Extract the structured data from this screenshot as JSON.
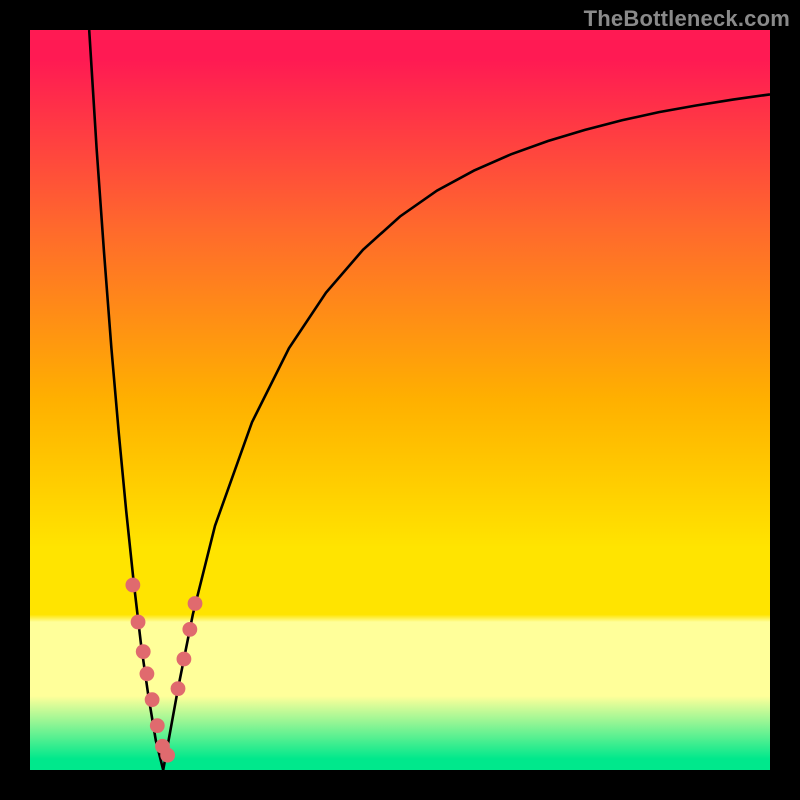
{
  "watermark": "TheBottleneck.com",
  "colors": {
    "gradient_top": "#ff1a53",
    "gradient_mid1": "#ff6a2c",
    "gradient_mid2": "#ffb000",
    "gradient_mid3": "#ffe400",
    "gradient_band": "#ffff9a",
    "gradient_bottom": "#00e88c",
    "curve": "#000000",
    "marker": "#e06a6e",
    "frame": "#000000"
  },
  "chart_data": {
    "type": "line",
    "title": "",
    "xlabel": "",
    "ylabel": "",
    "xlim": [
      0,
      100
    ],
    "ylim": [
      0,
      100
    ],
    "x_optimum": 18,
    "series": [
      {
        "name": "left-branch",
        "x": [
          8.0,
          9.0,
          10.0,
          11.0,
          12.0,
          13.0,
          14.0,
          15.0,
          16.0,
          17.0,
          18.0
        ],
        "values": [
          100.0,
          84.0,
          70.0,
          57.0,
          45.5,
          35.0,
          25.5,
          17.0,
          10.0,
          4.0,
          0.0
        ]
      },
      {
        "name": "right-branch",
        "x": [
          18.0,
          20.0,
          22.0,
          25.0,
          30.0,
          35.0,
          40.0,
          45.0,
          50.0,
          55.0,
          60.0,
          65.0,
          70.0,
          75.0,
          80.0,
          85.0,
          90.0,
          95.0,
          100.0
        ],
        "values": [
          0.0,
          11.0,
          21.0,
          33.0,
          47.0,
          57.0,
          64.5,
          70.3,
          74.8,
          78.3,
          81.0,
          83.2,
          85.0,
          86.5,
          87.8,
          88.9,
          89.8,
          90.6,
          91.3
        ]
      }
    ],
    "markers": {
      "name": "near-optimum-points",
      "x": [
        13.9,
        14.6,
        15.3,
        15.8,
        16.5,
        17.2,
        17.9,
        18.6,
        20.0,
        20.8,
        21.6,
        22.3
      ],
      "values": [
        25.0,
        20.0,
        16.0,
        13.0,
        9.5,
        6.0,
        3.2,
        2.0,
        11.0,
        15.0,
        19.0,
        22.5
      ],
      "radius_data_units": 1.0
    },
    "gradient_stops": [
      {
        "offset": 0.0,
        "color": "#ff1a53"
      },
      {
        "offset": 0.04,
        "color": "#ff1a53"
      },
      {
        "offset": 0.27,
        "color": "#ff6a2c"
      },
      {
        "offset": 0.5,
        "color": "#ffb000"
      },
      {
        "offset": 0.7,
        "color": "#ffe400"
      },
      {
        "offset": 0.79,
        "color": "#ffe400"
      },
      {
        "offset": 0.8,
        "color": "#ffff9a"
      },
      {
        "offset": 0.9,
        "color": "#ffff9a"
      },
      {
        "offset": 0.985,
        "color": "#00e88c"
      },
      {
        "offset": 1.0,
        "color": "#00e88c"
      }
    ]
  }
}
